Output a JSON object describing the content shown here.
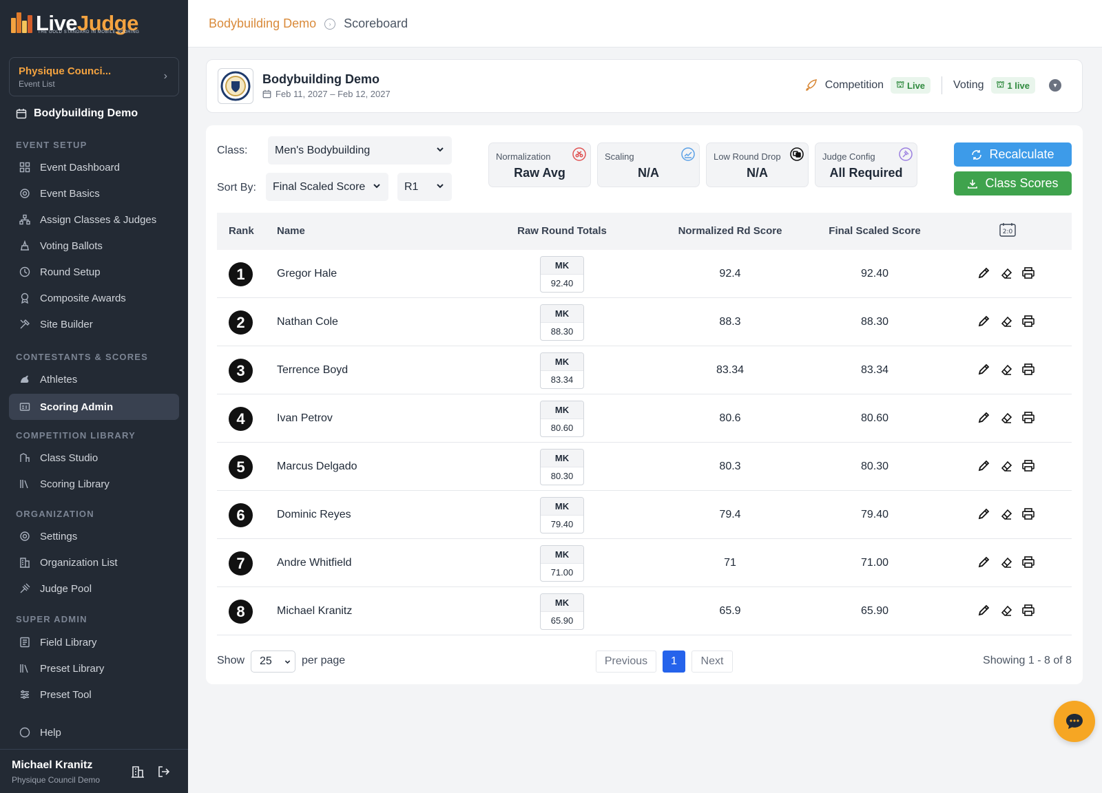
{
  "brand": {
    "name_part1": "Live",
    "name_part2": "Judge",
    "tagline": "THE GOLD STANDARD IN MOBILE SCORING"
  },
  "org_card": {
    "name": "Physique Counci...",
    "sub": "Event List"
  },
  "event_link": "Bodybuilding Demo",
  "sidebar": {
    "sections": [
      {
        "title": "EVENT SETUP",
        "items": [
          "Event Dashboard",
          "Event Basics",
          "Assign Classes & Judges",
          "Voting Ballots",
          "Round Setup",
          "Composite Awards",
          "Site Builder"
        ]
      },
      {
        "title": "CONTESTANTS & SCORES",
        "items": [
          "Athletes",
          "Scoring Admin"
        ]
      },
      {
        "title": "COMPETITION LIBRARY",
        "items": [
          "Class Studio",
          "Scoring Library"
        ]
      },
      {
        "title": "ORGANIZATION",
        "items": [
          "Settings",
          "Organization List",
          "Judge Pool"
        ]
      },
      {
        "title": "SUPER ADMIN",
        "items": [
          "Field Library",
          "Preset Library",
          "Preset Tool",
          "Help"
        ]
      }
    ],
    "active_item": "Scoring Admin"
  },
  "user": {
    "name": "Michael Kranitz",
    "org": "Physique Council Demo"
  },
  "breadcrumb": {
    "parent": "Bodybuilding Demo",
    "current": "Scoreboard"
  },
  "event": {
    "title": "Bodybuilding Demo",
    "dates": "Feb 11, 2027 – Feb 12, 2027",
    "competition_label": "Competition",
    "competition_status": "Live",
    "voting_label": "Voting",
    "voting_status": "1 live"
  },
  "filters": {
    "class_label": "Class:",
    "class_value": "Men's Bodybuilding",
    "sort_label": "Sort By:",
    "sort_value": "Final Scaled Score",
    "round_value": "R1"
  },
  "metrics": [
    {
      "label": "Normalization",
      "value": "Raw Avg",
      "icon": "scissors-icon",
      "color": "#e05252"
    },
    {
      "label": "Scaling",
      "value": "N/A",
      "icon": "chart-icon",
      "color": "#5aa0e6"
    },
    {
      "label": "Low Round Drop",
      "value": "N/A",
      "icon": "dice-icon",
      "color": "#111111"
    },
    {
      "label": "Judge Config",
      "value": "All Required",
      "icon": "gavel-icon",
      "color": "#9b7fe0"
    }
  ],
  "buttons": {
    "recalculate": "Recalculate",
    "class_scores": "Class Scores"
  },
  "table": {
    "headers": {
      "rank": "Rank",
      "name": "Name",
      "raw": "Raw Round Totals",
      "normalized": "Normalized Rd Score",
      "final": "Final Scaled Score"
    },
    "rows": [
      {
        "rank": "1",
        "name": "Gregor Hale",
        "mk_label": "MK",
        "raw": "92.40",
        "normalized": "92.4",
        "final": "92.40"
      },
      {
        "rank": "2",
        "name": "Nathan Cole",
        "mk_label": "MK",
        "raw": "88.30",
        "normalized": "88.3",
        "final": "88.30"
      },
      {
        "rank": "3",
        "name": "Terrence Boyd",
        "mk_label": "MK",
        "raw": "83.34",
        "normalized": "83.34",
        "final": "83.34"
      },
      {
        "rank": "4",
        "name": "Ivan Petrov",
        "mk_label": "MK",
        "raw": "80.60",
        "normalized": "80.6",
        "final": "80.60"
      },
      {
        "rank": "5",
        "name": "Marcus Delgado",
        "mk_label": "MK",
        "raw": "80.30",
        "normalized": "80.3",
        "final": "80.30"
      },
      {
        "rank": "6",
        "name": "Dominic Reyes",
        "mk_label": "MK",
        "raw": "79.40",
        "normalized": "79.4",
        "final": "79.40"
      },
      {
        "rank": "7",
        "name": "Andre Whitfield",
        "mk_label": "MK",
        "raw": "71.00",
        "normalized": "71",
        "final": "71.00"
      },
      {
        "rank": "8",
        "name": "Michael Kranitz",
        "mk_label": "MK",
        "raw": "65.90",
        "normalized": "65.9",
        "final": "65.90"
      }
    ]
  },
  "pagination": {
    "show": "Show",
    "per_page_value": "25",
    "per_page": "per page",
    "previous": "Previous",
    "current": "1",
    "next": "Next",
    "info": "Showing 1 - 8 of 8"
  }
}
